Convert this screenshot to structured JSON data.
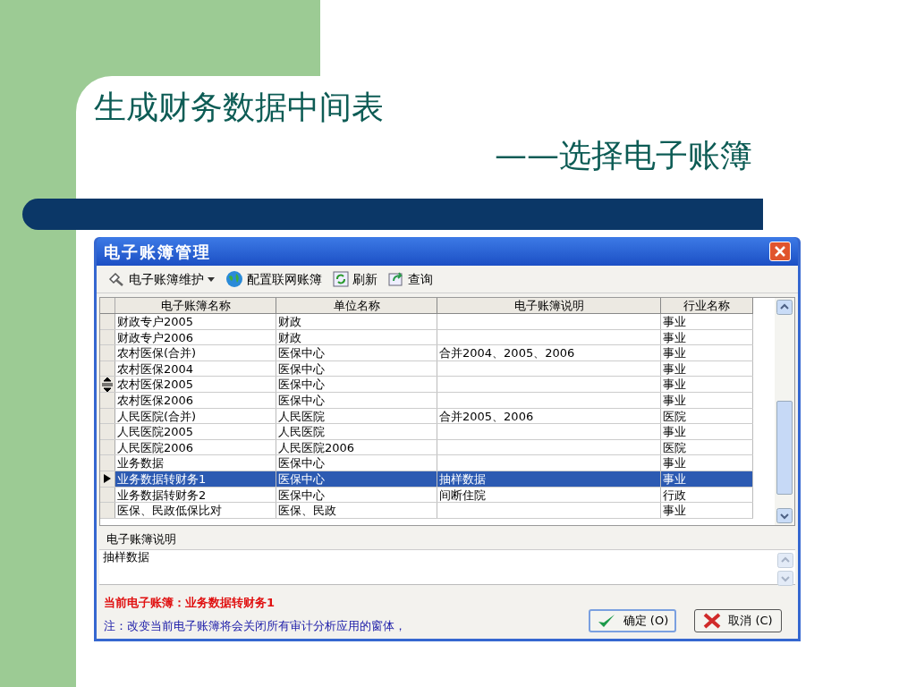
{
  "slide": {
    "title": "生成财务数据中间表",
    "subtitle": "——选择电子账簿"
  },
  "window": {
    "title": "电子账簿管理"
  },
  "toolbar": [
    {
      "label": "电子账簿维护",
      "kind": "maintain",
      "dropdown": true
    },
    {
      "label": "配置联网账簿",
      "kind": "globe",
      "dropdown": false
    },
    {
      "label": "刷新",
      "kind": "refresh",
      "dropdown": false
    },
    {
      "label": "查询",
      "kind": "query",
      "dropdown": false
    }
  ],
  "table": {
    "columns": [
      "电子账簿名称",
      "单位名称",
      "电子账簿说明",
      "行业名称"
    ],
    "rows": [
      {
        "cells": [
          "财政专户2005",
          "财政",
          "",
          "事业"
        ],
        "selected": false
      },
      {
        "cells": [
          "财政专户2006",
          "财政",
          "",
          "事业"
        ],
        "selected": false
      },
      {
        "cells": [
          "农村医保(合并)",
          "医保中心",
          "合并2004、2005、2006",
          "事业"
        ],
        "selected": false
      },
      {
        "cells": [
          "农村医保2004",
          "医保中心",
          "",
          "事业"
        ],
        "selected": false
      },
      {
        "cells": [
          "农村医保2005",
          "医保中心",
          "",
          "事业"
        ],
        "selected": false
      },
      {
        "cells": [
          "农村医保2006",
          "医保中心",
          "",
          "事业"
        ],
        "selected": false
      },
      {
        "cells": [
          "人民医院(合并)",
          "人民医院",
          "合并2005、2006",
          "医院"
        ],
        "selected": false
      },
      {
        "cells": [
          "人民医院2005",
          "人民医院",
          "",
          "事业"
        ],
        "selected": false
      },
      {
        "cells": [
          "人民医院2006",
          "人民医院2006",
          "",
          "医院"
        ],
        "selected": false
      },
      {
        "cells": [
          "业务数据",
          "医保中心",
          "",
          "事业"
        ],
        "selected": false
      },
      {
        "cells": [
          "业务数据转财务1",
          "医保中心",
          "抽样数据",
          "事业"
        ],
        "selected": true
      },
      {
        "cells": [
          "业务数据转财务2",
          "医保中心",
          "间断住院",
          "行政"
        ],
        "selected": false
      },
      {
        "cells": [
          "医保、民政低保比对",
          "医保、民政",
          "",
          "事业"
        ],
        "selected": false
      }
    ]
  },
  "description": {
    "label": "电子账簿说明",
    "value": "抽样数据"
  },
  "current": "当前电子账簿：业务数据转财务1",
  "note": "注：改变当前电子账簿将会关闭所有审计分析应用的窗体，",
  "buttons": [
    {
      "label": "确定 (O)",
      "kind": "ok",
      "focused": true
    },
    {
      "label": "取消 (C)",
      "kind": "cancel",
      "focused": false
    }
  ]
}
